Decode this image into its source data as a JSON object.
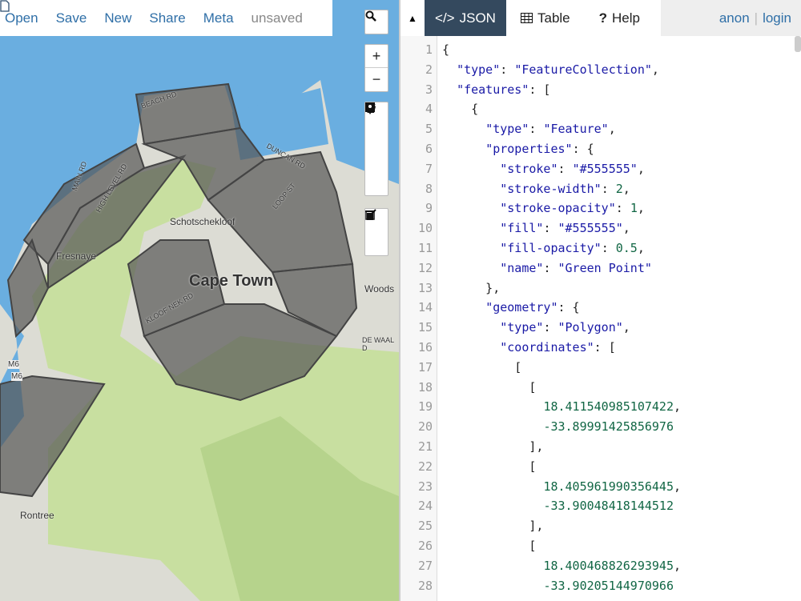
{
  "topbar": {
    "open": "Open",
    "save": "Save",
    "new": "New",
    "share": "Share",
    "meta": "Meta",
    "file_status": "unsaved"
  },
  "map": {
    "labels": {
      "city": "Cape Town",
      "schotsche": "Schotschekloof",
      "fresnaye": "Fresnaye",
      "woods": "Woods",
      "rontree": "Rontree",
      "beach": "BEACH RD",
      "main": "MAIN RD",
      "high": "HIGH LEVEL RD",
      "duncan": "DUNCAN RD",
      "loop": "LOOP ST",
      "kloof": "KLOOF NEK RD",
      "dewaal": "DE WAAL D",
      "m6a": "M6",
      "m6b": "M6"
    },
    "colors": {
      "sea": "#6aaee0",
      "land": "#c8dfa0",
      "polygon": "#555555"
    }
  },
  "panel": {
    "tabs": {
      "json": "JSON",
      "table": "Table",
      "help": "Help"
    },
    "auth": {
      "anon": "anon",
      "sep": "|",
      "login": "login"
    }
  },
  "editor": {
    "lines": [
      [
        [
          "p",
          "{"
        ]
      ],
      [
        [
          "p",
          "  "
        ],
        [
          "k",
          "\"type\""
        ],
        [
          "p",
          ": "
        ],
        [
          "s",
          "\"FeatureCollection\""
        ],
        [
          "p",
          ","
        ]
      ],
      [
        [
          "p",
          "  "
        ],
        [
          "k",
          "\"features\""
        ],
        [
          "p",
          ": ["
        ]
      ],
      [
        [
          "p",
          "    {"
        ]
      ],
      [
        [
          "p",
          "      "
        ],
        [
          "k",
          "\"type\""
        ],
        [
          "p",
          ": "
        ],
        [
          "s",
          "\"Feature\""
        ],
        [
          "p",
          ","
        ]
      ],
      [
        [
          "p",
          "      "
        ],
        [
          "k",
          "\"properties\""
        ],
        [
          "p",
          ": {"
        ]
      ],
      [
        [
          "p",
          "        "
        ],
        [
          "k",
          "\"stroke\""
        ],
        [
          "p",
          ": "
        ],
        [
          "s",
          "\"#555555\""
        ],
        [
          "p",
          ","
        ]
      ],
      [
        [
          "p",
          "        "
        ],
        [
          "k",
          "\"stroke-width\""
        ],
        [
          "p",
          ": "
        ],
        [
          "n",
          "2"
        ],
        [
          "p",
          ","
        ]
      ],
      [
        [
          "p",
          "        "
        ],
        [
          "k",
          "\"stroke-opacity\""
        ],
        [
          "p",
          ": "
        ],
        [
          "n",
          "1"
        ],
        [
          "p",
          ","
        ]
      ],
      [
        [
          "p",
          "        "
        ],
        [
          "k",
          "\"fill\""
        ],
        [
          "p",
          ": "
        ],
        [
          "s",
          "\"#555555\""
        ],
        [
          "p",
          ","
        ]
      ],
      [
        [
          "p",
          "        "
        ],
        [
          "k",
          "\"fill-opacity\""
        ],
        [
          "p",
          ": "
        ],
        [
          "n",
          "0.5"
        ],
        [
          "p",
          ","
        ]
      ],
      [
        [
          "p",
          "        "
        ],
        [
          "k",
          "\"name\""
        ],
        [
          "p",
          ": "
        ],
        [
          "s",
          "\"Green Point\""
        ]
      ],
      [
        [
          "p",
          "      },"
        ]
      ],
      [
        [
          "p",
          "      "
        ],
        [
          "k",
          "\"geometry\""
        ],
        [
          "p",
          ": {"
        ]
      ],
      [
        [
          "p",
          "        "
        ],
        [
          "k",
          "\"type\""
        ],
        [
          "p",
          ": "
        ],
        [
          "s",
          "\"Polygon\""
        ],
        [
          "p",
          ","
        ]
      ],
      [
        [
          "p",
          "        "
        ],
        [
          "k",
          "\"coordinates\""
        ],
        [
          "p",
          ": ["
        ]
      ],
      [
        [
          "p",
          "          ["
        ]
      ],
      [
        [
          "p",
          "            ["
        ]
      ],
      [
        [
          "p",
          "              "
        ],
        [
          "n",
          "18.411540985107422"
        ],
        [
          "p",
          ","
        ]
      ],
      [
        [
          "p",
          "              "
        ],
        [
          "n",
          "-33.89991425856976"
        ]
      ],
      [
        [
          "p",
          "            ],"
        ]
      ],
      [
        [
          "p",
          "            ["
        ]
      ],
      [
        [
          "p",
          "              "
        ],
        [
          "n",
          "18.405961990356445"
        ],
        [
          "p",
          ","
        ]
      ],
      [
        [
          "p",
          "              "
        ],
        [
          "n",
          "-33.90048418144512"
        ]
      ],
      [
        [
          "p",
          "            ],"
        ]
      ],
      [
        [
          "p",
          "            ["
        ]
      ],
      [
        [
          "p",
          "              "
        ],
        [
          "n",
          "18.400468826293945"
        ],
        [
          "p",
          ","
        ]
      ],
      [
        [
          "p",
          "              "
        ],
        [
          "n",
          "-33.90205144970966"
        ]
      ]
    ]
  }
}
